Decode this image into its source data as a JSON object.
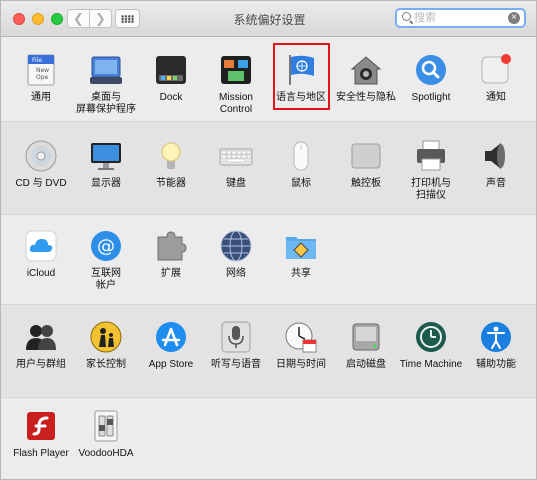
{
  "window": {
    "title": "系统偏好设置",
    "search": {
      "placeholder": "搜索"
    }
  },
  "rows": [
    {
      "panes": [
        {
          "id": "general",
          "label": "通用",
          "icon": "general-icon"
        },
        {
          "id": "desktop",
          "label": "桌面与\n屏幕保护程序",
          "icon": "desktop-icon"
        },
        {
          "id": "dock",
          "label": "Dock",
          "icon": "dock-icon"
        },
        {
          "id": "mission",
          "label": "Mission\nControl",
          "icon": "mission-control-icon"
        },
        {
          "id": "language",
          "label": "语言与地区",
          "icon": "flag-icon",
          "highlighted": true
        },
        {
          "id": "security",
          "label": "安全性与隐私",
          "icon": "house-icon"
        },
        {
          "id": "spotlight",
          "label": "Spotlight",
          "icon": "magnifier-icon"
        },
        {
          "id": "notifications",
          "label": "通知",
          "icon": "notification-icon"
        }
      ]
    },
    {
      "panes": [
        {
          "id": "cd",
          "label": "CD 与 DVD",
          "icon": "disc-icon"
        },
        {
          "id": "displays",
          "label": "显示器",
          "icon": "display-icon"
        },
        {
          "id": "energy",
          "label": "节能器",
          "icon": "bulb-icon"
        },
        {
          "id": "keyboard",
          "label": "键盘",
          "icon": "keyboard-icon"
        },
        {
          "id": "mouse",
          "label": "鼠标",
          "icon": "mouse-icon"
        },
        {
          "id": "trackpad",
          "label": "触控板",
          "icon": "trackpad-icon"
        },
        {
          "id": "printers",
          "label": "打印机与\n扫描仪",
          "icon": "printer-icon"
        },
        {
          "id": "sound",
          "label": "声音",
          "icon": "speaker-icon"
        }
      ]
    },
    {
      "panes": [
        {
          "id": "icloud",
          "label": "iCloud",
          "icon": "cloud-icon"
        },
        {
          "id": "internet",
          "label": "互联网\n帐户",
          "icon": "at-icon"
        },
        {
          "id": "extensions",
          "label": "扩展",
          "icon": "puzzle-icon"
        },
        {
          "id": "network",
          "label": "网络",
          "icon": "globe-icon"
        },
        {
          "id": "sharing",
          "label": "共享",
          "icon": "sharing-folder-icon"
        }
      ]
    },
    {
      "panes": [
        {
          "id": "users",
          "label": "用户与群组",
          "icon": "users-icon"
        },
        {
          "id": "parental",
          "label": "家长控制",
          "icon": "parental-icon"
        },
        {
          "id": "appstore",
          "label": "App Store",
          "icon": "appstore-icon"
        },
        {
          "id": "dictation",
          "label": "听写与语音",
          "icon": "microphone-icon"
        },
        {
          "id": "datetime",
          "label": "日期与时间",
          "icon": "clock-icon"
        },
        {
          "id": "startup",
          "label": "启动磁盘",
          "icon": "hard-disk-icon"
        },
        {
          "id": "timemachine",
          "label": "Time Machine",
          "icon": "time-machine-icon"
        },
        {
          "id": "accessibility",
          "label": "辅助功能",
          "icon": "accessibility-icon"
        }
      ]
    },
    {
      "panes": [
        {
          "id": "flash",
          "label": "Flash Player",
          "icon": "flash-icon"
        },
        {
          "id": "voodoo",
          "label": "VoodooHDA",
          "icon": "switch-icon"
        }
      ]
    }
  ]
}
